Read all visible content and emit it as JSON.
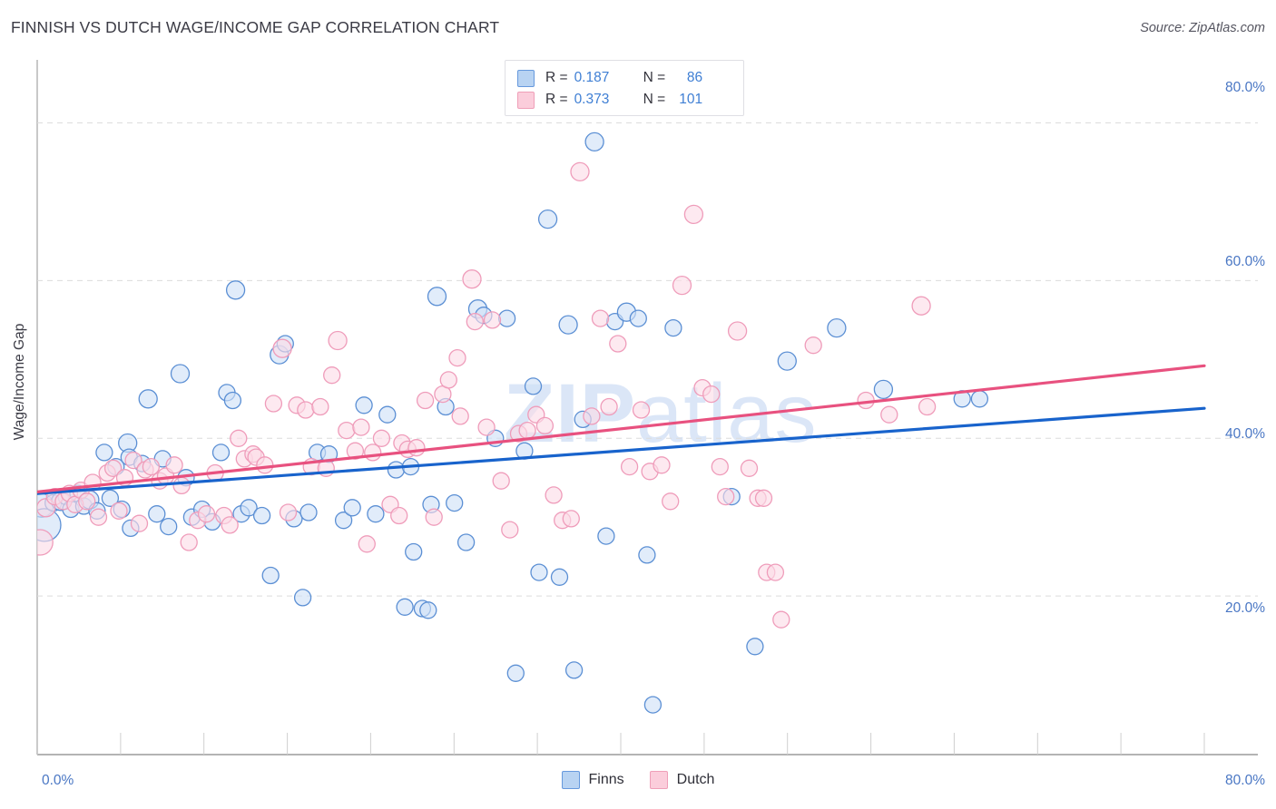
{
  "title": "FINNISH VS DUTCH WAGE/INCOME GAP CORRELATION CHART",
  "source": "Source: ZipAtlas.com",
  "watermark": {
    "bold": "ZIP",
    "light": "atlas"
  },
  "axes": {
    "ylabel": "Wage/Income Gap",
    "xlabel": "",
    "x_left_label": "0.0%",
    "x_right_label": "80.0%",
    "ytick_labels": [
      "80.0%",
      "60.0%",
      "40.0%",
      "20.0%"
    ]
  },
  "stats_legend": {
    "rows": [
      {
        "color": "#b8d3f2",
        "r_key": "R =",
        "r_value": "0.187",
        "n_key": "N =",
        "n_value": "86"
      },
      {
        "color": "#fbcddb",
        "r_key": "R =",
        "r_value": "0.373",
        "n_key": "N =",
        "n_value": "101"
      }
    ]
  },
  "bottom_legend": [
    {
      "label": "Finns",
      "color": "#b8d3f2"
    },
    {
      "label": "Dutch",
      "color": "#fbcddb"
    }
  ],
  "colors": {
    "finns_fill": "#cfe0f7",
    "finns_stroke": "#5b8fd4",
    "dutch_fill": "#fbdce6",
    "dutch_stroke": "#ef9cba",
    "finns_line": "#1863cc",
    "dutch_line": "#e8517f",
    "grid": "#dcdcdc",
    "axis": "#c0c0c0",
    "tick_text": "#4a77c4",
    "title_text": "#3b3b45"
  },
  "chart_data": {
    "type": "scatter",
    "title": "FINNISH VS DUTCH WAGE/INCOME GAP CORRELATION CHART",
    "xlabel": "",
    "ylabel": "Wage/Income Gap",
    "xlim": [
      0,
      80
    ],
    "ylim": [
      0,
      88
    ],
    "xticks": [
      0,
      80
    ],
    "yticks": [
      20,
      40,
      60,
      80
    ],
    "grid": true,
    "legend_position": "bottom-center",
    "series": [
      {
        "name": "Finns",
        "color": "#cfe0f7",
        "stroke": "#5b8fd4",
        "R": 0.187,
        "N": 86,
        "trendline": {
          "x": [
            0,
            80
          ],
          "y": [
            33.0,
            43.8
          ]
        },
        "points": [
          [
            0.3,
            31.5,
            13
          ],
          [
            0.5,
            29.0,
            18
          ],
          [
            1.1,
            31.8,
            9
          ],
          [
            1.6,
            32.0,
            10
          ],
          [
            2.0,
            32.6,
            9
          ],
          [
            2.3,
            31.0,
            9
          ],
          [
            2.8,
            33.0,
            9
          ],
          [
            3.2,
            31.4,
            9
          ],
          [
            3.6,
            32.2,
            10
          ],
          [
            4.1,
            30.8,
            9
          ],
          [
            4.6,
            38.2,
            9
          ],
          [
            5.0,
            32.4,
            9
          ],
          [
            5.4,
            36.4,
            9
          ],
          [
            5.8,
            31.0,
            9
          ],
          [
            6.2,
            39.4,
            10
          ],
          [
            6.3,
            37.6,
            9
          ],
          [
            6.4,
            28.6,
            9
          ],
          [
            7.2,
            36.8,
            9
          ],
          [
            7.6,
            45.0,
            10
          ],
          [
            8.2,
            30.4,
            9
          ],
          [
            8.6,
            37.4,
            9
          ],
          [
            9.0,
            28.8,
            9
          ],
          [
            9.8,
            48.2,
            10
          ],
          [
            10.2,
            35.0,
            9
          ],
          [
            10.6,
            30.0,
            9
          ],
          [
            11.3,
            31.0,
            9
          ],
          [
            12.0,
            29.4,
            9
          ],
          [
            12.6,
            38.2,
            9
          ],
          [
            13.0,
            45.8,
            9
          ],
          [
            13.4,
            44.8,
            9
          ],
          [
            13.6,
            58.8,
            10
          ],
          [
            14.0,
            30.4,
            9
          ],
          [
            14.5,
            31.2,
            9
          ],
          [
            15.4,
            30.2,
            9
          ],
          [
            16.0,
            22.6,
            9
          ],
          [
            16.6,
            50.6,
            10
          ],
          [
            17.0,
            52.0,
            9
          ],
          [
            17.6,
            29.8,
            9
          ],
          [
            18.2,
            19.8,
            9
          ],
          [
            18.6,
            30.6,
            9
          ],
          [
            19.2,
            38.2,
            9
          ],
          [
            20.0,
            38.0,
            9
          ],
          [
            21.0,
            29.6,
            9
          ],
          [
            21.6,
            31.2,
            9
          ],
          [
            22.4,
            44.2,
            9
          ],
          [
            23.2,
            30.4,
            9
          ],
          [
            24.0,
            43.0,
            9
          ],
          [
            24.6,
            36.0,
            9
          ],
          [
            25.2,
            18.6,
            9
          ],
          [
            25.6,
            36.4,
            9
          ],
          [
            25.8,
            25.6,
            9
          ],
          [
            26.4,
            18.4,
            9
          ],
          [
            26.8,
            18.2,
            9
          ],
          [
            27.0,
            31.6,
            9
          ],
          [
            27.4,
            58.0,
            10
          ],
          [
            28.0,
            44.0,
            9
          ],
          [
            28.6,
            31.8,
            9
          ],
          [
            29.4,
            26.8,
            9
          ],
          [
            30.2,
            56.4,
            10
          ],
          [
            30.6,
            55.6,
            9
          ],
          [
            31.4,
            40.0,
            9
          ],
          [
            32.2,
            55.2,
            9
          ],
          [
            32.8,
            10.2,
            9
          ],
          [
            33.4,
            38.4,
            9
          ],
          [
            34.0,
            46.6,
            9
          ],
          [
            34.4,
            23.0,
            9
          ],
          [
            35.0,
            67.8,
            10
          ],
          [
            35.8,
            22.4,
            9
          ],
          [
            36.4,
            54.4,
            10
          ],
          [
            36.8,
            10.6,
            9
          ],
          [
            37.4,
            42.4,
            9
          ],
          [
            38.2,
            77.6,
            10
          ],
          [
            39.0,
            27.6,
            9
          ],
          [
            39.6,
            54.8,
            9
          ],
          [
            40.4,
            56.0,
            10
          ],
          [
            41.2,
            55.2,
            9
          ],
          [
            41.8,
            25.2,
            9
          ],
          [
            42.2,
            6.2,
            9
          ],
          [
            43.6,
            54.0,
            9
          ],
          [
            47.6,
            32.6,
            9
          ],
          [
            49.2,
            13.6,
            9
          ],
          [
            51.4,
            49.8,
            10
          ],
          [
            54.8,
            54.0,
            10
          ],
          [
            58.0,
            46.2,
            10
          ],
          [
            63.4,
            45.0,
            9
          ],
          [
            64.6,
            45.0,
            9
          ]
        ]
      },
      {
        "name": "Dutch",
        "color": "#fbdce6",
        "stroke": "#ef9cba",
        "R": 0.373,
        "N": 101,
        "trendline": {
          "x": [
            0,
            80
          ],
          "y": [
            33.2,
            49.2
          ]
        },
        "points": [
          [
            0.2,
            26.8,
            14
          ],
          [
            0.6,
            31.2,
            10
          ],
          [
            1.2,
            32.6,
            9
          ],
          [
            1.8,
            32.0,
            9
          ],
          [
            2.2,
            33.0,
            9
          ],
          [
            2.6,
            31.6,
            9
          ],
          [
            3.0,
            33.4,
            9
          ],
          [
            3.4,
            32.0,
            9
          ],
          [
            3.8,
            34.4,
            9
          ],
          [
            4.2,
            30.0,
            9
          ],
          [
            4.8,
            35.6,
            9
          ],
          [
            5.2,
            36.2,
            9
          ],
          [
            5.6,
            30.8,
            9
          ],
          [
            6.0,
            35.0,
            9
          ],
          [
            6.6,
            37.2,
            9
          ],
          [
            7.0,
            29.2,
            9
          ],
          [
            7.4,
            36.0,
            9
          ],
          [
            7.8,
            36.4,
            9
          ],
          [
            8.4,
            34.6,
            9
          ],
          [
            8.8,
            35.2,
            9
          ],
          [
            9.4,
            36.6,
            9
          ],
          [
            9.9,
            34.0,
            9
          ],
          [
            10.4,
            26.8,
            9
          ],
          [
            11.0,
            29.6,
            9
          ],
          [
            11.6,
            30.4,
            9
          ],
          [
            12.2,
            35.6,
            9
          ],
          [
            12.8,
            30.2,
            9
          ],
          [
            13.2,
            29.0,
            9
          ],
          [
            13.8,
            40.0,
            9
          ],
          [
            14.2,
            37.4,
            9
          ],
          [
            14.8,
            38.0,
            9
          ],
          [
            15.0,
            37.6,
            9
          ],
          [
            15.6,
            36.6,
            9
          ],
          [
            16.2,
            44.4,
            9
          ],
          [
            16.8,
            51.4,
            10
          ],
          [
            17.2,
            30.6,
            9
          ],
          [
            17.8,
            44.2,
            9
          ],
          [
            18.4,
            43.6,
            9
          ],
          [
            18.8,
            36.4,
            9
          ],
          [
            19.4,
            44.0,
            9
          ],
          [
            19.8,
            36.2,
            9
          ],
          [
            20.2,
            48.0,
            9
          ],
          [
            20.6,
            52.4,
            10
          ],
          [
            21.2,
            41.0,
            9
          ],
          [
            21.8,
            38.4,
            9
          ],
          [
            22.2,
            41.4,
            9
          ],
          [
            22.6,
            26.6,
            9
          ],
          [
            23.0,
            38.2,
            9
          ],
          [
            23.6,
            40.0,
            9
          ],
          [
            24.2,
            31.6,
            9
          ],
          [
            24.8,
            30.2,
            9
          ],
          [
            25.0,
            39.4,
            9
          ],
          [
            25.4,
            38.6,
            9
          ],
          [
            26.0,
            38.8,
            9
          ],
          [
            26.6,
            44.8,
            9
          ],
          [
            27.2,
            30.0,
            9
          ],
          [
            27.8,
            45.6,
            9
          ],
          [
            28.2,
            47.4,
            9
          ],
          [
            28.8,
            50.2,
            9
          ],
          [
            29.0,
            42.8,
            9
          ],
          [
            29.8,
            60.2,
            10
          ],
          [
            30.0,
            54.8,
            9
          ],
          [
            30.8,
            41.4,
            9
          ],
          [
            31.2,
            55.0,
            9
          ],
          [
            31.8,
            34.6,
            9
          ],
          [
            32.4,
            28.4,
            9
          ],
          [
            33.0,
            40.6,
            9
          ],
          [
            33.6,
            41.0,
            9
          ],
          [
            34.2,
            43.0,
            9
          ],
          [
            34.8,
            41.6,
            9
          ],
          [
            35.4,
            32.8,
            9
          ],
          [
            36.0,
            29.6,
            9
          ],
          [
            36.6,
            29.8,
            9
          ],
          [
            37.2,
            73.8,
            10
          ],
          [
            38.0,
            42.8,
            9
          ],
          [
            38.6,
            55.2,
            9
          ],
          [
            39.2,
            44.0,
            9
          ],
          [
            39.8,
            52.0,
            9
          ],
          [
            40.6,
            36.4,
            9
          ],
          [
            41.4,
            43.6,
            9
          ],
          [
            42.0,
            35.8,
            9
          ],
          [
            42.8,
            36.6,
            9
          ],
          [
            43.4,
            32.0,
            9
          ],
          [
            44.2,
            59.4,
            10
          ],
          [
            45.0,
            68.4,
            10
          ],
          [
            45.6,
            46.4,
            9
          ],
          [
            46.2,
            45.6,
            9
          ],
          [
            46.8,
            36.4,
            9
          ],
          [
            47.2,
            32.6,
            9
          ],
          [
            48.0,
            53.6,
            10
          ],
          [
            48.8,
            36.2,
            9
          ],
          [
            49.4,
            32.4,
            9
          ],
          [
            49.8,
            32.4,
            9
          ],
          [
            50.0,
            23.0,
            9
          ],
          [
            50.6,
            23.0,
            9
          ],
          [
            51.0,
            17.0,
            9
          ],
          [
            53.2,
            51.8,
            9
          ],
          [
            56.8,
            44.8,
            9
          ],
          [
            58.4,
            43.0,
            9
          ],
          [
            60.6,
            56.8,
            10
          ],
          [
            61.0,
            44.0,
            9
          ]
        ]
      }
    ]
  }
}
